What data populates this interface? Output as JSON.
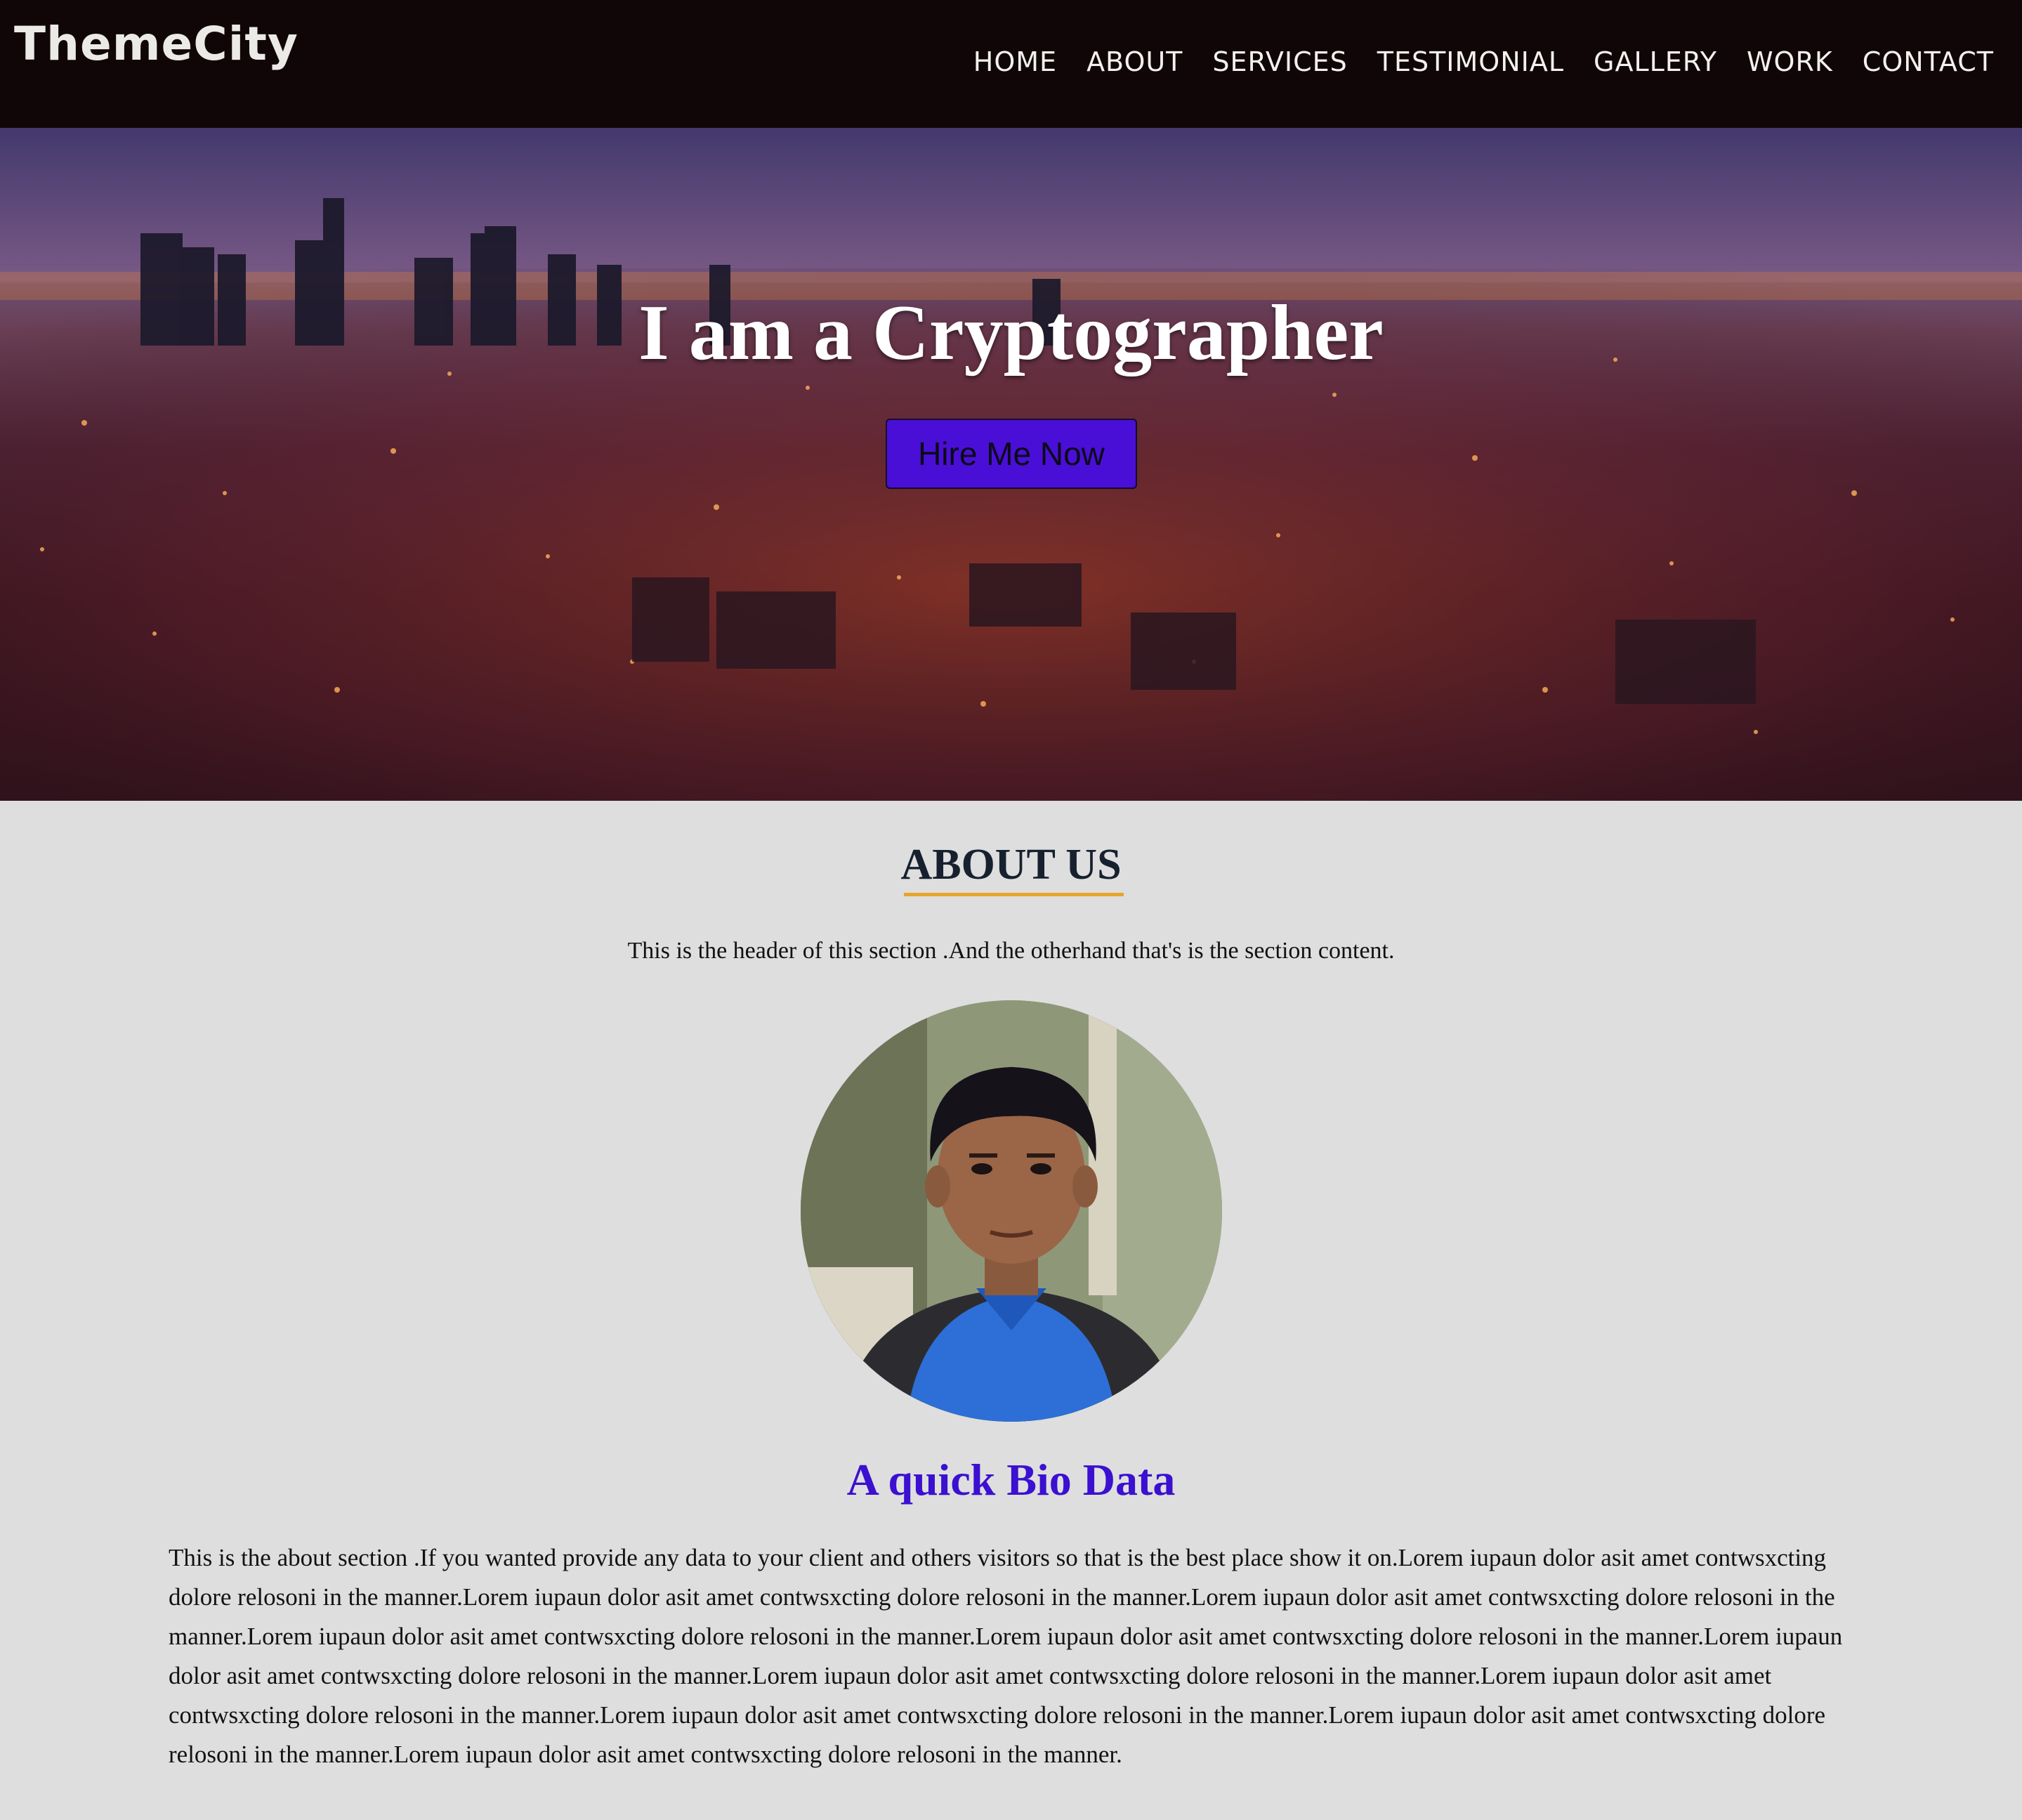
{
  "navbar": {
    "brand": "ThemeCity",
    "links": [
      "HOME",
      "ABOUT",
      "SERVICES",
      "TESTIMONIAL",
      "GALLERY",
      "WORK",
      "CONTACT"
    ]
  },
  "hero": {
    "title": "I am a Cryptographer",
    "button_label": "Hire Me Now"
  },
  "about": {
    "title": "ABOUT US",
    "subtitle": "This is the header of this section .And the otherhand that's is the section content.",
    "bio_title": "A quick Bio Data",
    "bio_text": "This is the about section .If you wanted provide any data to your client and others visitors so that is the best place show it on.Lorem iupaun dolor asit amet contwsxcting dolore relosoni in the manner.Lorem iupaun dolor asit amet contwsxcting dolore relosoni in the manner.Lorem iupaun dolor asit amet contwsxcting dolore relosoni in the manner.Lorem iupaun dolor asit amet contwsxcting dolore relosoni in the manner.Lorem iupaun dolor asit amet contwsxcting dolore relosoni in the manner.Lorem iupaun dolor asit amet contwsxcting dolore relosoni in the manner.Lorem iupaun dolor asit amet contwsxcting dolore relosoni in the manner.Lorem iupaun dolor asit amet contwsxcting dolore relosoni in the manner.Lorem iupaun dolor asit amet contwsxcting dolore relosoni in the manner.Lorem iupaun dolor asit amet contwsxcting dolore relosoni in the manner.Lorem iupaun dolor asit amet contwsxcting dolore relosoni in the manner."
  },
  "colors": {
    "navbar_bg": "#100607",
    "button_bg": "#4a0fd6",
    "underline": "#e7a52b",
    "bio_title": "#3b10d0",
    "page_bg": "#dedede"
  }
}
